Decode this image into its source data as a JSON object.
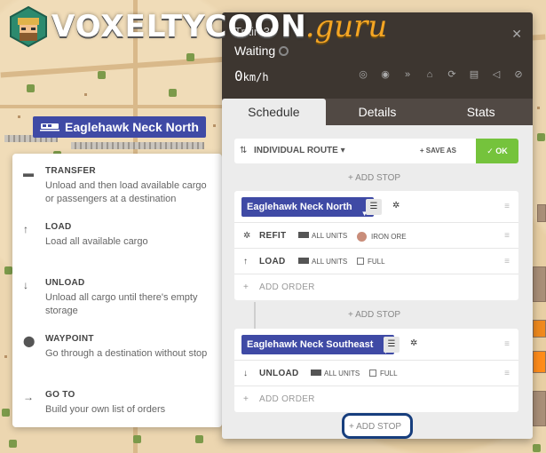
{
  "logo": {
    "text": "VOXELTYCOON",
    "suffix": ".guru"
  },
  "station_label": "Eaglehawk Neck North",
  "order_types": [
    {
      "icon": "transfer-icon",
      "title": "TRANSFER",
      "desc": "Unload and then load available cargo or passengers at a destination"
    },
    {
      "icon": "arrow-up-icon",
      "title": "LOAD",
      "desc": "Load all available cargo"
    },
    {
      "icon": "arrow-down-icon",
      "title": "UNLOAD",
      "desc": "Unload all cargo until there's empty storage"
    },
    {
      "icon": "waypoint-icon",
      "title": "WAYPOINT",
      "desc": "Go through a destination without stop"
    },
    {
      "icon": "arrow-right-icon",
      "title": "GO TO",
      "desc": "Build your own list of orders"
    }
  ],
  "window": {
    "title": "Train 36",
    "status": "Waiting",
    "speed_value": "0",
    "speed_unit": "km/h",
    "tabs": [
      "Schedule",
      "Details",
      "Stats"
    ],
    "route_mode": "INDIVIDUAL ROUTE",
    "save_as": "SAVE AS",
    "ok": "OK",
    "add_stop": "ADD STOP",
    "add_order": "ADD ORDER",
    "stops": [
      {
        "station": "Eaglehawk Neck North",
        "orders": [
          {
            "name": "REFIT",
            "units": "ALL UNITS",
            "extra": "IRON ORE"
          },
          {
            "name": "LOAD",
            "units": "ALL UNITS",
            "extra": "FULL"
          }
        ]
      },
      {
        "station": "Eaglehawk Neck Southeast",
        "orders": [
          {
            "name": "UNLOAD",
            "units": "ALL UNITS",
            "extra": "FULL"
          }
        ]
      }
    ]
  },
  "colors": {
    "accent": "#3f4aa5",
    "ok": "#75c33c",
    "highlight": "#173e7d",
    "header": "#3d3630"
  }
}
